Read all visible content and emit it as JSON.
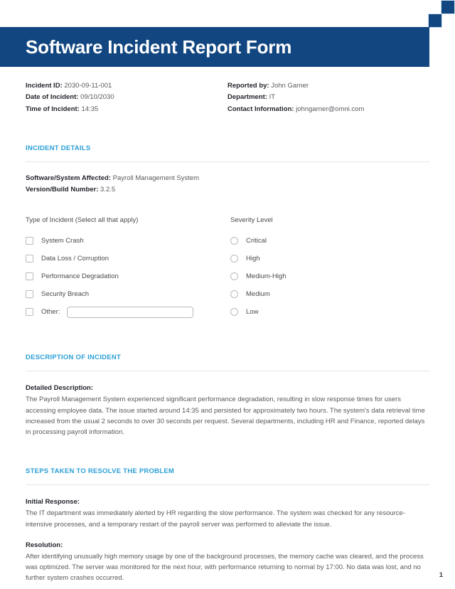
{
  "document": {
    "title": "Software Incident Report Form",
    "page_number": "1",
    "accent_header_color": "#124680",
    "accent_section_color": "#2a9fd6"
  },
  "meta": {
    "left": [
      {
        "label": "Incident ID:",
        "value": "2030-09-11-001"
      },
      {
        "label": "Date of Incident:",
        "value": "09/10/2030"
      },
      {
        "label": "Time of Incident:",
        "value": "14:35"
      }
    ],
    "right": [
      {
        "label": "Reported by:",
        "value": "John Garner"
      },
      {
        "label": "Department:",
        "value": "IT"
      },
      {
        "label": "Contact Information:",
        "value": "johngarner@omni.com"
      }
    ]
  },
  "incident_details": {
    "section_title": "INCIDENT DETAILS",
    "fields": [
      {
        "label": "Software/System Affected:",
        "value": "Payroll Management System"
      },
      {
        "label": "Version/Build Number:",
        "value": "3.2.5"
      }
    ],
    "incident_type": {
      "heading": "Type of Incident (Select all that apply)",
      "options": [
        {
          "label": "System Crash",
          "checked": false
        },
        {
          "label": "Data Loss / Corruption",
          "checked": false
        },
        {
          "label": "Performance Degradation",
          "checked": false
        },
        {
          "label": "Security Breach",
          "checked": false
        }
      ],
      "other": {
        "label": "Other:",
        "checked": false,
        "value": "",
        "placeholder": ""
      }
    },
    "severity": {
      "heading": "Severity Level",
      "options": [
        {
          "label": "Critical",
          "selected": false
        },
        {
          "label": "High",
          "selected": false
        },
        {
          "label": "Medium-High",
          "selected": false
        },
        {
          "label": "Medium",
          "selected": false
        },
        {
          "label": "Low",
          "selected": false
        }
      ]
    }
  },
  "description": {
    "section_title": "DESCRIPTION OF INCIDENT",
    "detailed": {
      "label": "Detailed Description:",
      "text": "The Payroll Management System experienced significant performance degradation, resulting in slow response times for users accessing employee data. The issue started around 14:35 and persisted for approximately two hours. The system's data retrieval time increased from the usual 2 seconds to over 30 seconds per request. Several departments, including HR and Finance, reported delays in processing payroll information."
    }
  },
  "steps": {
    "section_title": "STEPS TAKEN TO RESOLVE THE PROBLEM",
    "initial_response": {
      "label": "Initial Response:",
      "text": "The IT department was immediately alerted by HR regarding the slow performance. The system was checked for any resource-intensive processes, and a temporary restart of the payroll server was performed to alleviate the issue."
    },
    "resolution": {
      "label": "Resolution:",
      "text": "After identifying unusually high memory usage by one of the background processes, the memory cache was cleared, and the process was optimized. The server was monitored for the next hour, with performance returning to normal by 17:00. No data was lost, and no further system crashes occurred."
    }
  }
}
